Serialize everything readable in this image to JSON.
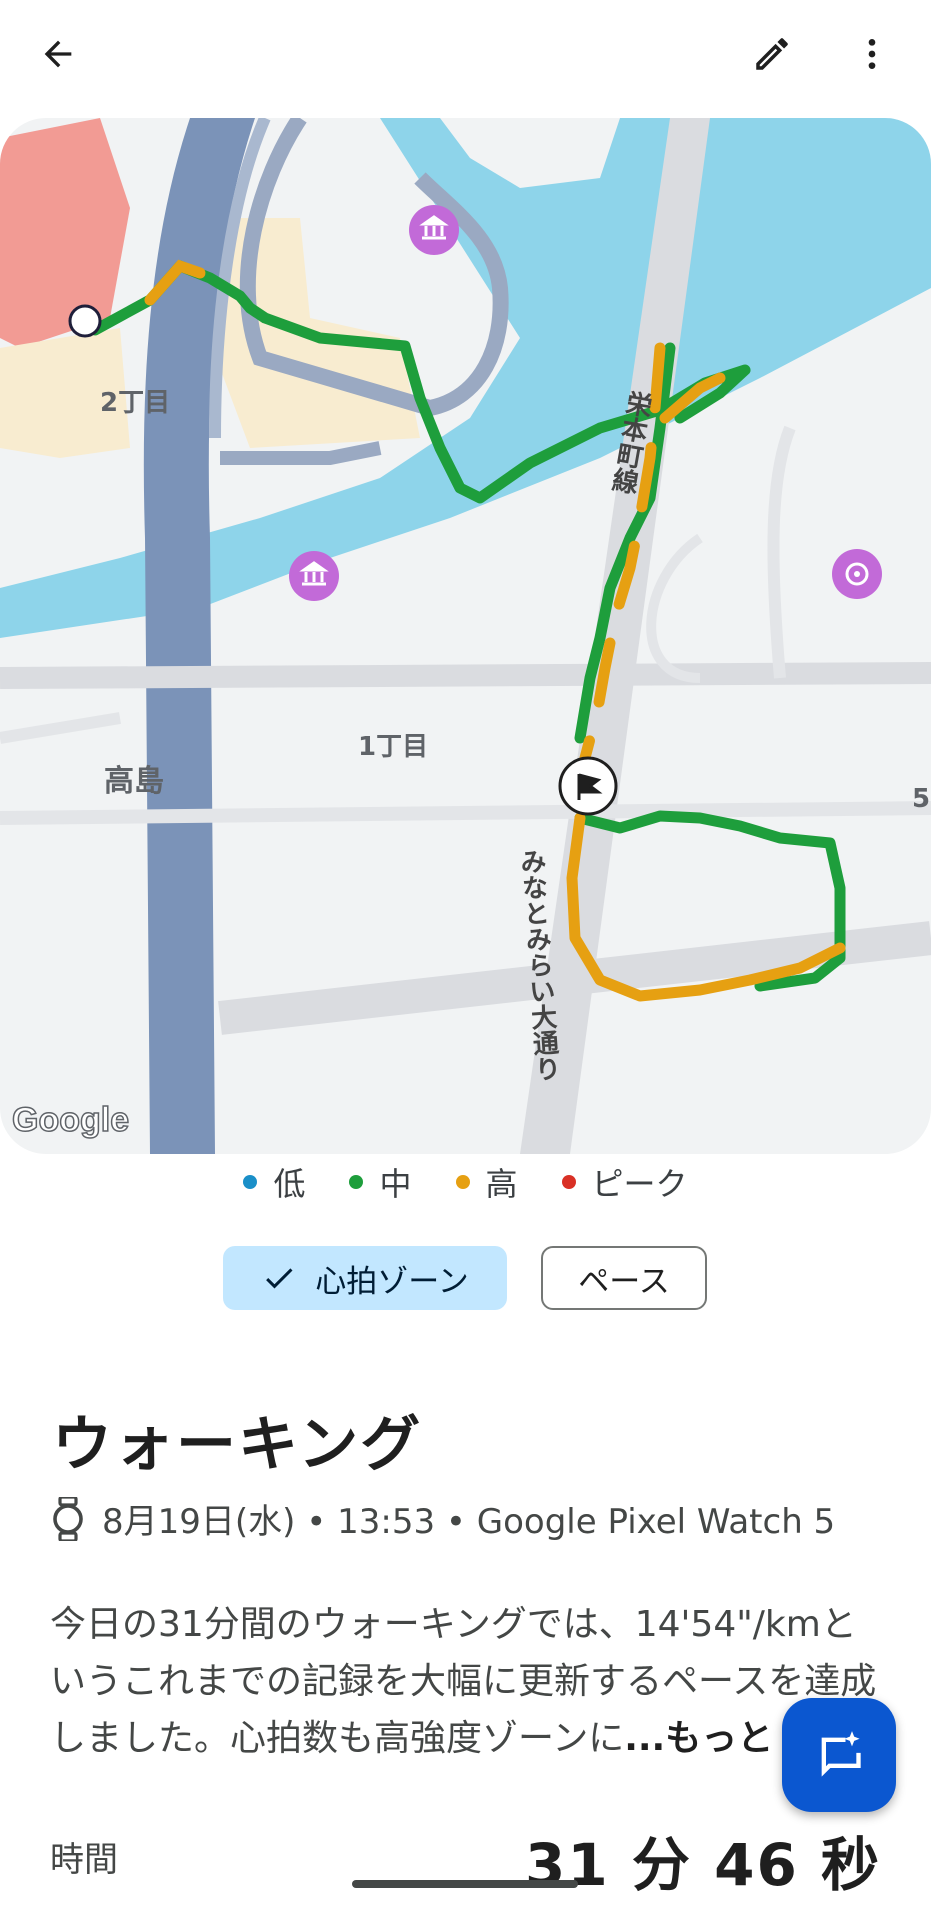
{
  "map": {
    "labels": [
      "2丁目",
      "1丁目",
      "高島",
      "栄本町線",
      "みなとみらい大通り",
      "5"
    ],
    "attribution": "Google"
  },
  "legend": [
    {
      "label": "低",
      "color": "#1a8fc8"
    },
    {
      "label": "中",
      "color": "#1e9e3c"
    },
    {
      "label": "高",
      "color": "#e6a012"
    },
    {
      "label": "ピーク",
      "color": "#d93025"
    }
  ],
  "chips": {
    "heart_rate": "心拍ゾーン",
    "pace": "ペース"
  },
  "activity": {
    "title": "ウォーキング",
    "meta": "8月19日(水) • 13:53 • Google Pixel Watch 5",
    "description": "今日の31分間のウォーキングでは、14'54\"/kmというこれまでの記録を大幅に更新するペースを達成しました。心拍数も高強度ゾーンに",
    "more": "...もっと"
  },
  "stats": {
    "time_label": "時間",
    "time_value": "31 分 46 秒"
  }
}
